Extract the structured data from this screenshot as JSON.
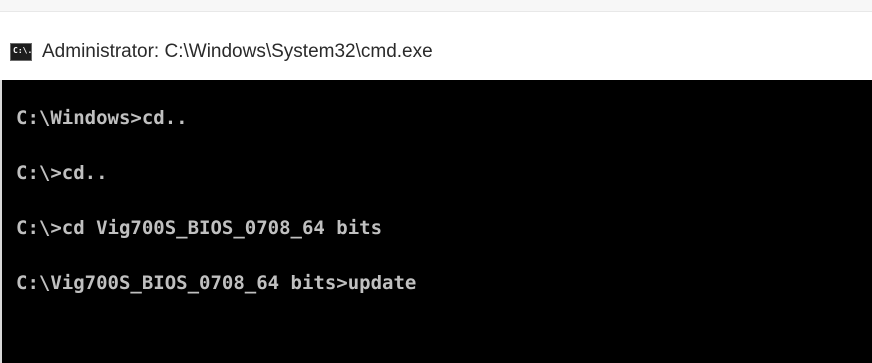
{
  "window": {
    "title": "Administrator: C:\\Windows\\System32\\cmd.exe",
    "icon": "command-prompt-icon",
    "icon_label": "C:\\."
  },
  "console": {
    "background": "#000000",
    "text_color": "#c0c0c0",
    "lines": [
      "C:\\Windows>cd..",
      "C:\\>cd..",
      "C:\\>cd Vig700S_BIOS_0708_64 bits",
      "C:\\Vig700S_BIOS_0708_64 bits>update"
    ]
  }
}
